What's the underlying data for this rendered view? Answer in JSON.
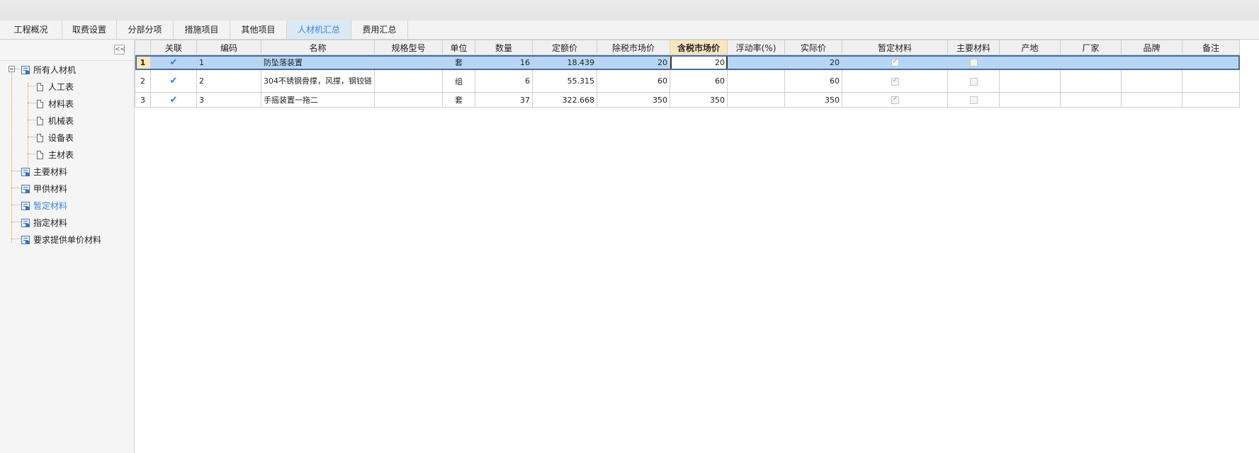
{
  "tabs": [
    {
      "label": "工程概况",
      "active": false
    },
    {
      "label": "取费设置",
      "active": false
    },
    {
      "label": "分部分项",
      "active": false
    },
    {
      "label": "措施项目",
      "active": false
    },
    {
      "label": "其他项目",
      "active": false
    },
    {
      "label": "人材机汇总",
      "active": true
    },
    {
      "label": "费用汇总",
      "active": false
    }
  ],
  "sidebar": {
    "collapse_label": "<<",
    "tree": {
      "root": "所有人材机",
      "children": [
        "人工表",
        "材料表",
        "机械表",
        "设备表",
        "主材表"
      ],
      "siblings": [
        "主要材料",
        "甲供材料",
        "暂定材料",
        "指定材料",
        "要求提供单价材料"
      ],
      "selected": "暂定材料"
    }
  },
  "table": {
    "columns": [
      "关联",
      "编码",
      "名称",
      "规格型号",
      "单位",
      "数量",
      "定额价",
      "除税市场价",
      "含税市场价",
      "浮动率(%)",
      "实际价",
      "暂定材料",
      "主要材料",
      "产地",
      "厂家",
      "品牌",
      "备注"
    ],
    "highlight_column": "含税市场价",
    "rows": [
      {
        "row_no": "1",
        "linked": true,
        "code": "1",
        "name": "防坠落装置",
        "spec": "",
        "unit": "套",
        "qty": "16",
        "quota_price": "18.439",
        "ex_tax_price": "20",
        "incl_tax_price": "20",
        "float_rate": "",
        "actual_price": "20",
        "provisional": true,
        "main_material": false,
        "origin": "",
        "manufacturer": "",
        "brand": "",
        "remark": ""
      },
      {
        "row_no": "2",
        "linked": true,
        "code": "2",
        "name": "304不锈钢骨撑，风撑，钢铰链",
        "spec": "",
        "unit": "组",
        "qty": "6",
        "quota_price": "55.315",
        "ex_tax_price": "60",
        "incl_tax_price": "60",
        "float_rate": "",
        "actual_price": "60",
        "provisional": true,
        "main_material": false,
        "origin": "",
        "manufacturer": "",
        "brand": "",
        "remark": ""
      },
      {
        "row_no": "3",
        "linked": true,
        "code": "3",
        "name": "手摇装置一拖二",
        "spec": "",
        "unit": "套",
        "qty": "37",
        "quota_price": "322.668",
        "ex_tax_price": "350",
        "incl_tax_price": "350",
        "float_rate": "",
        "actual_price": "350",
        "provisional": true,
        "main_material": false,
        "origin": "",
        "manufacturer": "",
        "brand": "",
        "remark": ""
      }
    ]
  }
}
